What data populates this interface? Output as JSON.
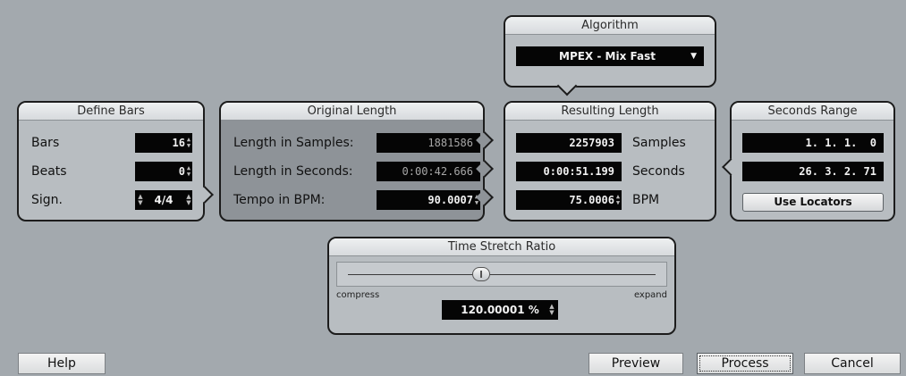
{
  "algorithm": {
    "title": "Algorithm",
    "selected": "MPEX - Mix Fast"
  },
  "define_bars": {
    "title": "Define Bars",
    "bars_label": "Bars",
    "bars_value": "16",
    "beats_label": "Beats",
    "beats_value": "0",
    "sign_label": "Sign.",
    "sign_value": "4/4"
  },
  "original_length": {
    "title": "Original Length",
    "samples_label": "Length in Samples:",
    "samples_value": "1881586",
    "seconds_label": "Length in Seconds:",
    "seconds_value": "0:00:42.666",
    "tempo_label": "Tempo in BPM:",
    "tempo_value": "90.0007"
  },
  "resulting_length": {
    "title": "Resulting Length",
    "samples_value": "2257903",
    "samples_unit": "Samples",
    "seconds_value": "0:00:51.199",
    "seconds_unit": "Seconds",
    "bpm_value": "75.0006",
    "bpm_unit": "BPM"
  },
  "seconds_range": {
    "title": "Seconds Range",
    "start": "1. 1. 1.  0",
    "end": "26. 3. 2. 71",
    "use_locators_label": "Use Locators"
  },
  "time_stretch": {
    "title": "Time Stretch Ratio",
    "compress_label": "compress",
    "expand_label": "expand",
    "ratio_value": "120.00001 %",
    "slider_position": 0.43
  },
  "buttons": {
    "help": "Help",
    "preview": "Preview",
    "process": "Process",
    "cancel": "Cancel"
  }
}
